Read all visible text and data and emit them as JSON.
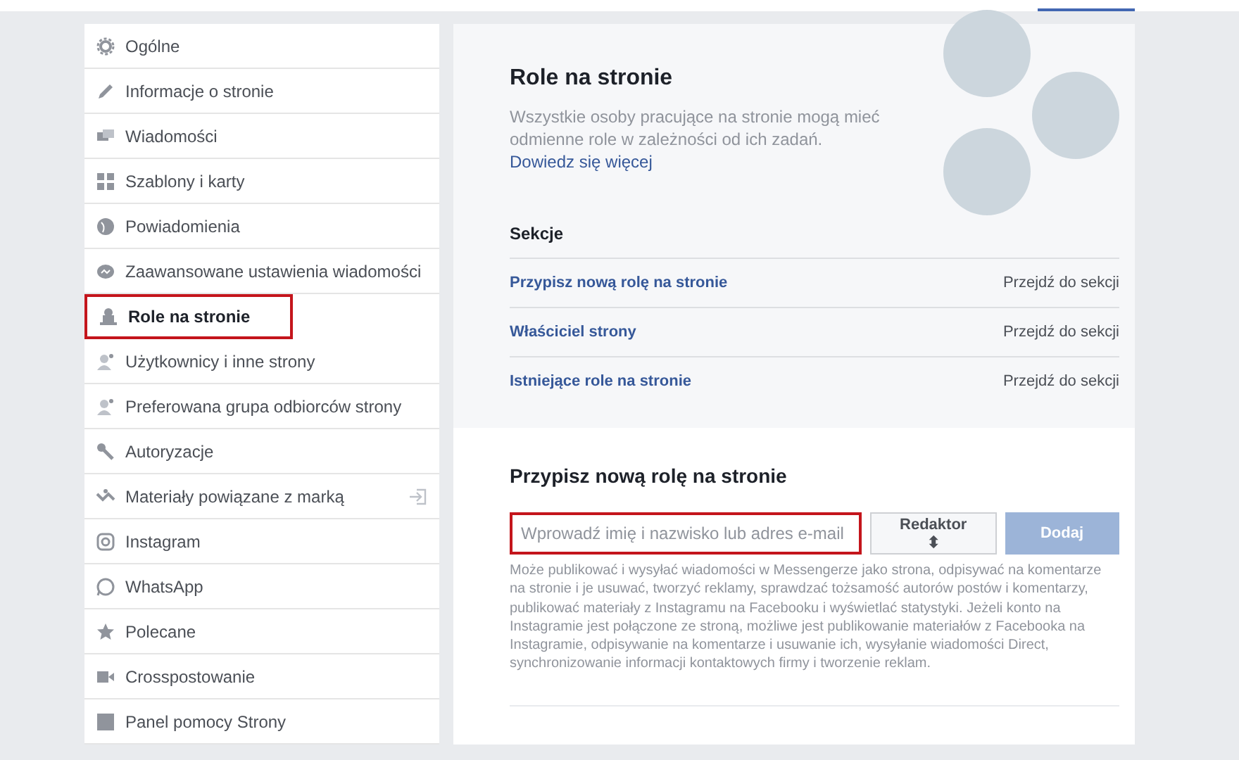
{
  "sidebar": {
    "items": [
      {
        "label": "Ogólne",
        "selected": false,
        "kind": "page"
      },
      {
        "label": "Informacje o stronie",
        "selected": false,
        "kind": "page"
      },
      {
        "label": "Wiadomości",
        "selected": false,
        "kind": "page"
      },
      {
        "label": "Szablony i karty",
        "selected": false,
        "kind": "page"
      },
      {
        "label": "Powiadomienia",
        "selected": false,
        "kind": "page"
      },
      {
        "label": "Zaawansowane ustawienia wiadomości",
        "selected": false,
        "kind": "page"
      },
      {
        "label": "Role na stronie",
        "selected": true,
        "kind": "page"
      },
      {
        "label": "Użytkownicy i inne strony",
        "selected": false,
        "kind": "page"
      },
      {
        "label": "Preferowana grupa odbiorców strony",
        "selected": false,
        "kind": "page"
      },
      {
        "label": "Autoryzacje",
        "selected": false,
        "kind": "page"
      },
      {
        "label": "Materiały powiązane z marką",
        "selected": false,
        "kind": "external"
      },
      {
        "label": "Instagram",
        "selected": false,
        "kind": "page"
      },
      {
        "label": "WhatsApp",
        "selected": false,
        "kind": "page"
      },
      {
        "label": "Polecane",
        "selected": false,
        "kind": "page"
      },
      {
        "label": "Crosspostowanie",
        "selected": false,
        "kind": "page"
      },
      {
        "label": "Panel pomocy Strony",
        "selected": false,
        "kind": "page"
      }
    ]
  },
  "intro": {
    "title": "Role na stronie",
    "description": "Wszystkie osoby pracujące na stronie mogą mieć odmienne role w zależności od ich zadań.",
    "link": "Dowiedz się więcej"
  },
  "sections": {
    "title": "Sekcje",
    "rows": [
      {
        "label": "Przypisz nową rolę na stronie",
        "action": "Przejdź do sekcji"
      },
      {
        "label": "Właściciel strony",
        "action": "Przejdź do sekcji"
      },
      {
        "label": "Istniejące role na stronie",
        "action": "Przejdź do sekcji"
      }
    ]
  },
  "assign": {
    "title": "Przypisz nową rolę na stronie",
    "input": {
      "placeholder": "Wprowadź imię i nazwisko lub adres e-mail",
      "highlighted": true
    },
    "role": "Redaktor",
    "role_caret": "⬍",
    "button": {
      "label": "Dodaj",
      "disabled": true
    },
    "help": "Może publikować i wysyłać wiadomości w Messengerze jako strona, odpisywać na komentarze na stronie i je usuwać, tworzyć reklamy, sprawdzać tożsamość autorów postów i komentarzy, publikować materiały z Instagramu na Facebooku i wyświetlać statystyki. Jeżeli konto na Instagramie jest połączone ze stroną, możliwe jest publikowanie materiałów z Facebooka na Instagramie, odpisywanie na komentarze i usuwanie ich, wysyłanie wiadomości Direct, synchronizowanie informacji kontaktowych firmy i tworzenie reklam."
  }
}
